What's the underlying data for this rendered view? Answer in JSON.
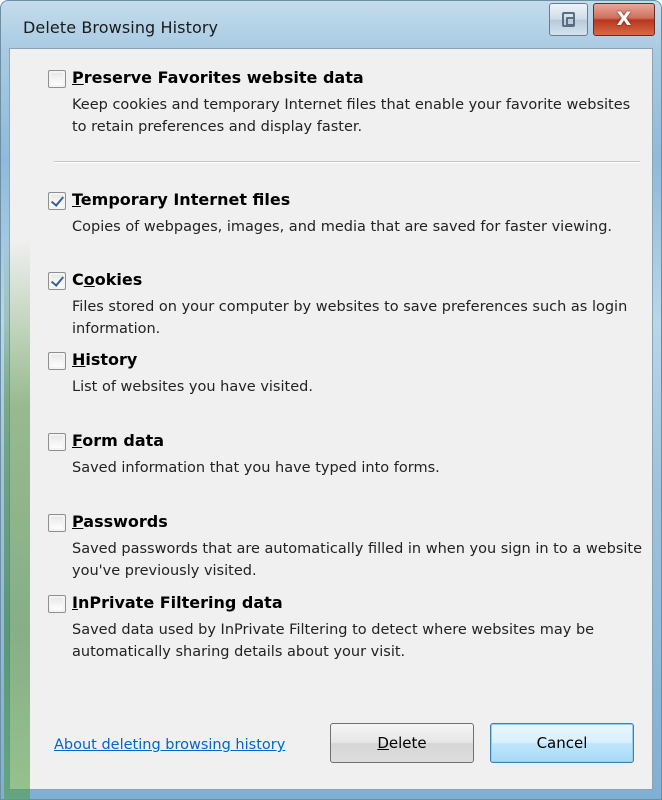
{
  "window": {
    "title": "Delete Browsing History",
    "help_glyph": "help-icon",
    "close_glyph": "X"
  },
  "options": [
    {
      "hotkey": "P",
      "rest": "reserve Favorites website data",
      "checked": false,
      "description": "Keep cookies and temporary Internet files that enable your favorite websites to retain preferences and display faster."
    },
    {
      "hotkey": "T",
      "rest": "emporary Internet files",
      "checked": true,
      "description": "Copies of webpages, images, and media that are saved for faster viewing."
    },
    {
      "pre": "C",
      "hotkey": "o",
      "rest": "okies",
      "checked": true,
      "description": "Files stored on your computer by websites to save preferences such as login information."
    },
    {
      "hotkey": "H",
      "rest": "istory",
      "checked": false,
      "description": "List of websites you have visited."
    },
    {
      "hotkey": "F",
      "rest": "orm data",
      "checked": false,
      "description": "Saved information that you have typed into forms."
    },
    {
      "hotkey": "P",
      "rest": "asswords",
      "checked": false,
      "description": "Saved passwords that are automatically filled in when you sign in to a website you've previously visited."
    },
    {
      "hotkey": "I",
      "rest": "nPrivate Filtering data",
      "checked": false,
      "description": "Saved data used by InPrivate Filtering to detect where websites may be automatically sharing details about your visit."
    }
  ],
  "footer": {
    "link": "About deleting browsing history",
    "delete_hotkey": "D",
    "delete_rest": "elete",
    "cancel": "Cancel"
  }
}
